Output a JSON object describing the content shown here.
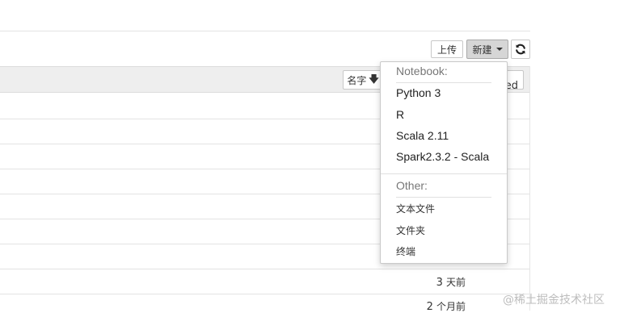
{
  "toolbar": {
    "upload_label": "上传",
    "new_label": "新建",
    "refresh_icon": "refresh-icon"
  },
  "list_header": {
    "sort_name_label": "名字",
    "sort_name_icon": "arrow-down-icon",
    "last_modified_label": "Last Modified"
  },
  "rows": [
    {
      "modified_num": "3",
      "modified_unit": "天前"
    },
    {
      "modified_num": "2",
      "modified_unit": "个月前"
    }
  ],
  "new_menu": {
    "notebook_header": "Notebook:",
    "notebook_items": [
      "Python 3",
      "R",
      "Scala 2.11",
      "Spark2.3.2 - Scala"
    ],
    "other_header": "Other:",
    "other_items": [
      "文本文件",
      "文件夹",
      "终端"
    ]
  },
  "watermark": "@稀土掘金技术社区",
  "colors": {
    "header_bg": "#eeeeee",
    "new_button_active_bg": "#d6d6d6"
  }
}
